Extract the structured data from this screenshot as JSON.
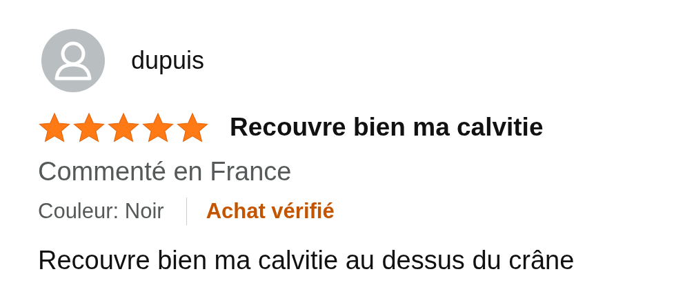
{
  "review": {
    "author": "dupuis",
    "stars": 5,
    "title": "Recouvre bien ma calvitie",
    "origin": "Commenté en France",
    "variant": "Couleur: Noir",
    "badge": "Achat vérifié",
    "body": "Recouvre bien ma calvitie au dessus du crâne"
  }
}
